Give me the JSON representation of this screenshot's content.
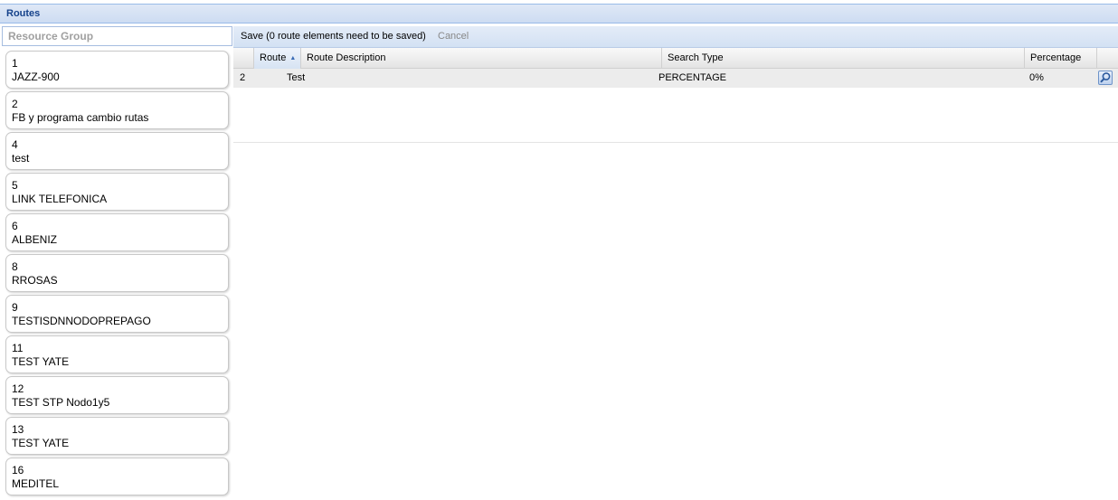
{
  "panel": {
    "title": "Routes"
  },
  "search": {
    "placeholder": "Resource Group",
    "value": ""
  },
  "resource_groups": [
    {
      "id": "1",
      "name": "JAZZ-900"
    },
    {
      "id": "2",
      "name": "FB y programa cambio rutas"
    },
    {
      "id": "4",
      "name": "test"
    },
    {
      "id": "5",
      "name": "LINK TELEFONICA"
    },
    {
      "id": "6",
      "name": "ALBENIZ"
    },
    {
      "id": "8",
      "name": "RROSAS"
    },
    {
      "id": "9",
      "name": "TESTISDNNODOPREPAGO"
    },
    {
      "id": "11",
      "name": "TEST YATE"
    },
    {
      "id": "12",
      "name": "TEST STP Nodo1y5"
    },
    {
      "id": "13",
      "name": "TEST YATE"
    },
    {
      "id": "16",
      "name": "MEDITEL"
    }
  ],
  "toolbar": {
    "save_label": "Save (0 route elements need to be saved)",
    "cancel_label": "Cancel"
  },
  "grid": {
    "columns": [
      "Route",
      "Route Description",
      "Search Type",
      "Percentage"
    ],
    "sorted_column": "Route",
    "sort_direction": "ascending",
    "rows": [
      {
        "index": "2",
        "route": "Test",
        "search_type": "PERCENTAGE",
        "percentage": "0%",
        "action_icon": "magnifier-icon"
      }
    ]
  },
  "colors": {
    "header_text": "#15428b",
    "header_border": "#99bbe8",
    "disabled_text": "#888888",
    "row_background": "#ececec"
  }
}
